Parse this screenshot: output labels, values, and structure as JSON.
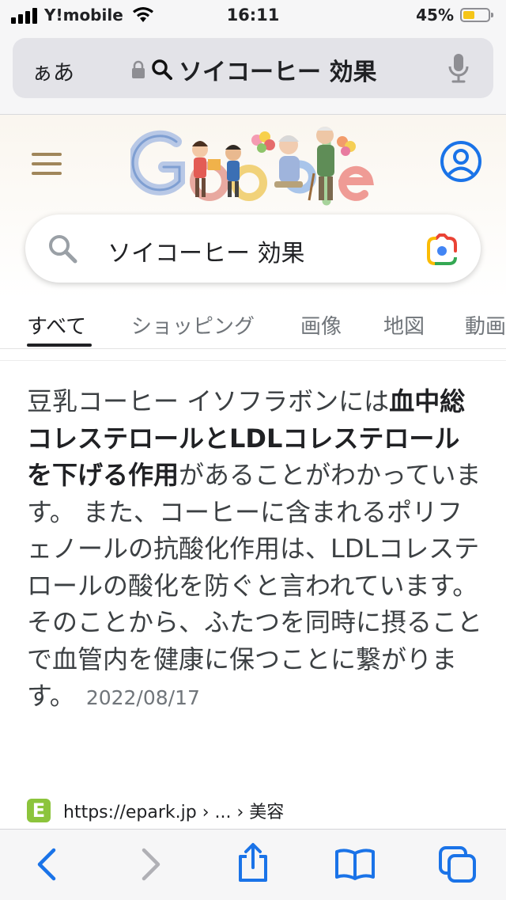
{
  "status": {
    "carrier": "Y!mobile",
    "time": "16:11",
    "battery_pct": "45%",
    "battery_level": 0.45
  },
  "address_bar": {
    "aa_label": "ぁあ",
    "url_text": "ソイコーヒー 効果"
  },
  "google": {
    "search_query": "ソイコーヒー 効果",
    "tabs": [
      "すべて",
      "ショッピング",
      "画像",
      "地図",
      "動画"
    ],
    "active_tab": 0
  },
  "result": {
    "snippet_pre": "豆乳コーヒー イソフラボンには",
    "snippet_bold": "血中総コレステロールとLDLコレステロールを下げる作用",
    "snippet_post": "があることがわかっています。 また、コーヒーに含まれるポリフェノールの抗酸化作用は、LDLコレステロールの酸化を防ぐと言われています。 そのことから、ふたつを同時に摂ることで血管内を健康に保つことに繋がります。",
    "date": "2022/08/17",
    "favicon_letter": "E",
    "source_url": "https://epark.jp › ... › 美容"
  },
  "colors": {
    "accent_blue": "#1a73e8",
    "ios_blue": "#1a73e8",
    "favicon_green": "#8cc43c"
  },
  "icons": {
    "toolbar": [
      "back-icon",
      "forward-icon",
      "share-icon",
      "bookmarks-icon",
      "tabs-icon"
    ],
    "header": [
      "menu-icon",
      "account-icon",
      "search-icon",
      "google-lens-icon",
      "microphone-icon",
      "lock-icon"
    ]
  }
}
